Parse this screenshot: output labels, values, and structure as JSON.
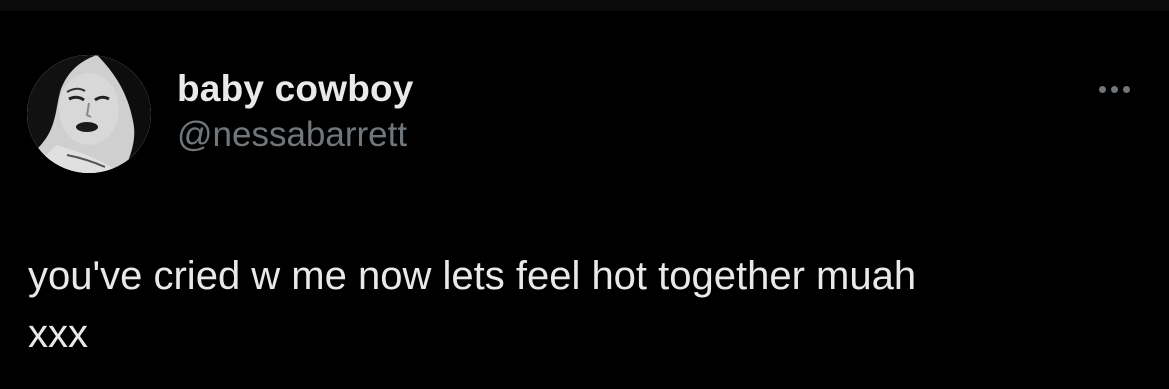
{
  "tweet": {
    "author": {
      "display_name": "baby cowboy",
      "handle": "@nessabarrett",
      "avatar_icon": "profile-photo"
    },
    "more_icon": "more-horizontal-icon",
    "text": "you've cried w me now lets feel hot together muah\nxxx"
  },
  "colors": {
    "background": "#000000",
    "primary_text": "#e7e9ea",
    "secondary_text": "#71767b"
  }
}
